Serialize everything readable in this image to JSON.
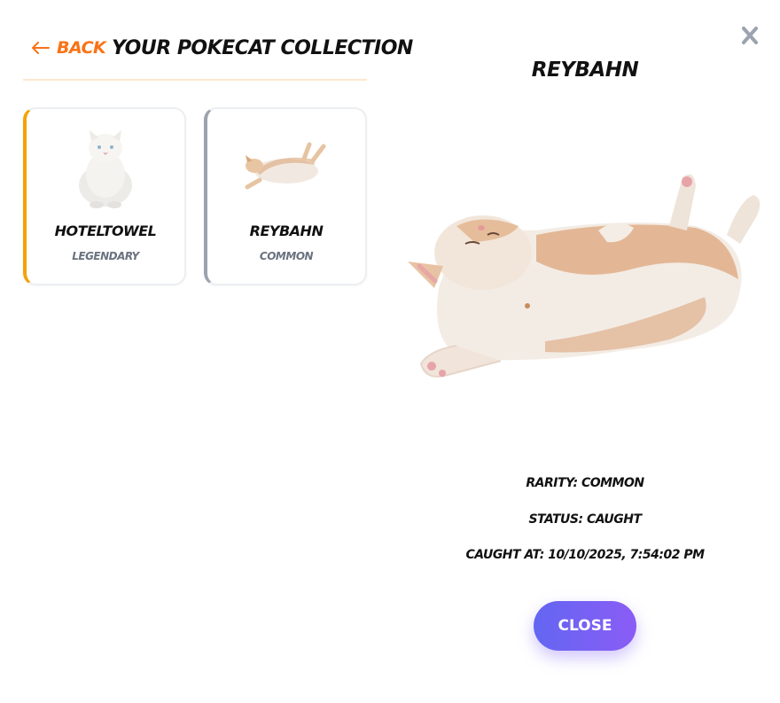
{
  "header": {
    "back_label": "Back",
    "title": "Your Pokecat Collection"
  },
  "cards": [
    {
      "name": "Hoteltowel",
      "rarity": "Legendary",
      "image": "white-persian-cat",
      "accent": "#f5a208"
    },
    {
      "name": "Reybahn",
      "rarity": "Common",
      "image": "orange-white-cat-lying",
      "accent": "#9ca3af"
    }
  ],
  "detail": {
    "close_icon": "x-icon",
    "title": "Reybahn",
    "image": "orange-white-cat-lying",
    "rarity_line": "Rarity: Common",
    "status_line": "Status: Caught",
    "caught_line": "Caught at: 10/10/2025, 7:54:02 PM",
    "close_label": "Close"
  },
  "colors": {
    "back": "#f97316",
    "legendary_accent": "#f5a208",
    "common_accent": "#9ca3af",
    "button_from": "#6366f1",
    "button_to": "#8b5cf6"
  }
}
